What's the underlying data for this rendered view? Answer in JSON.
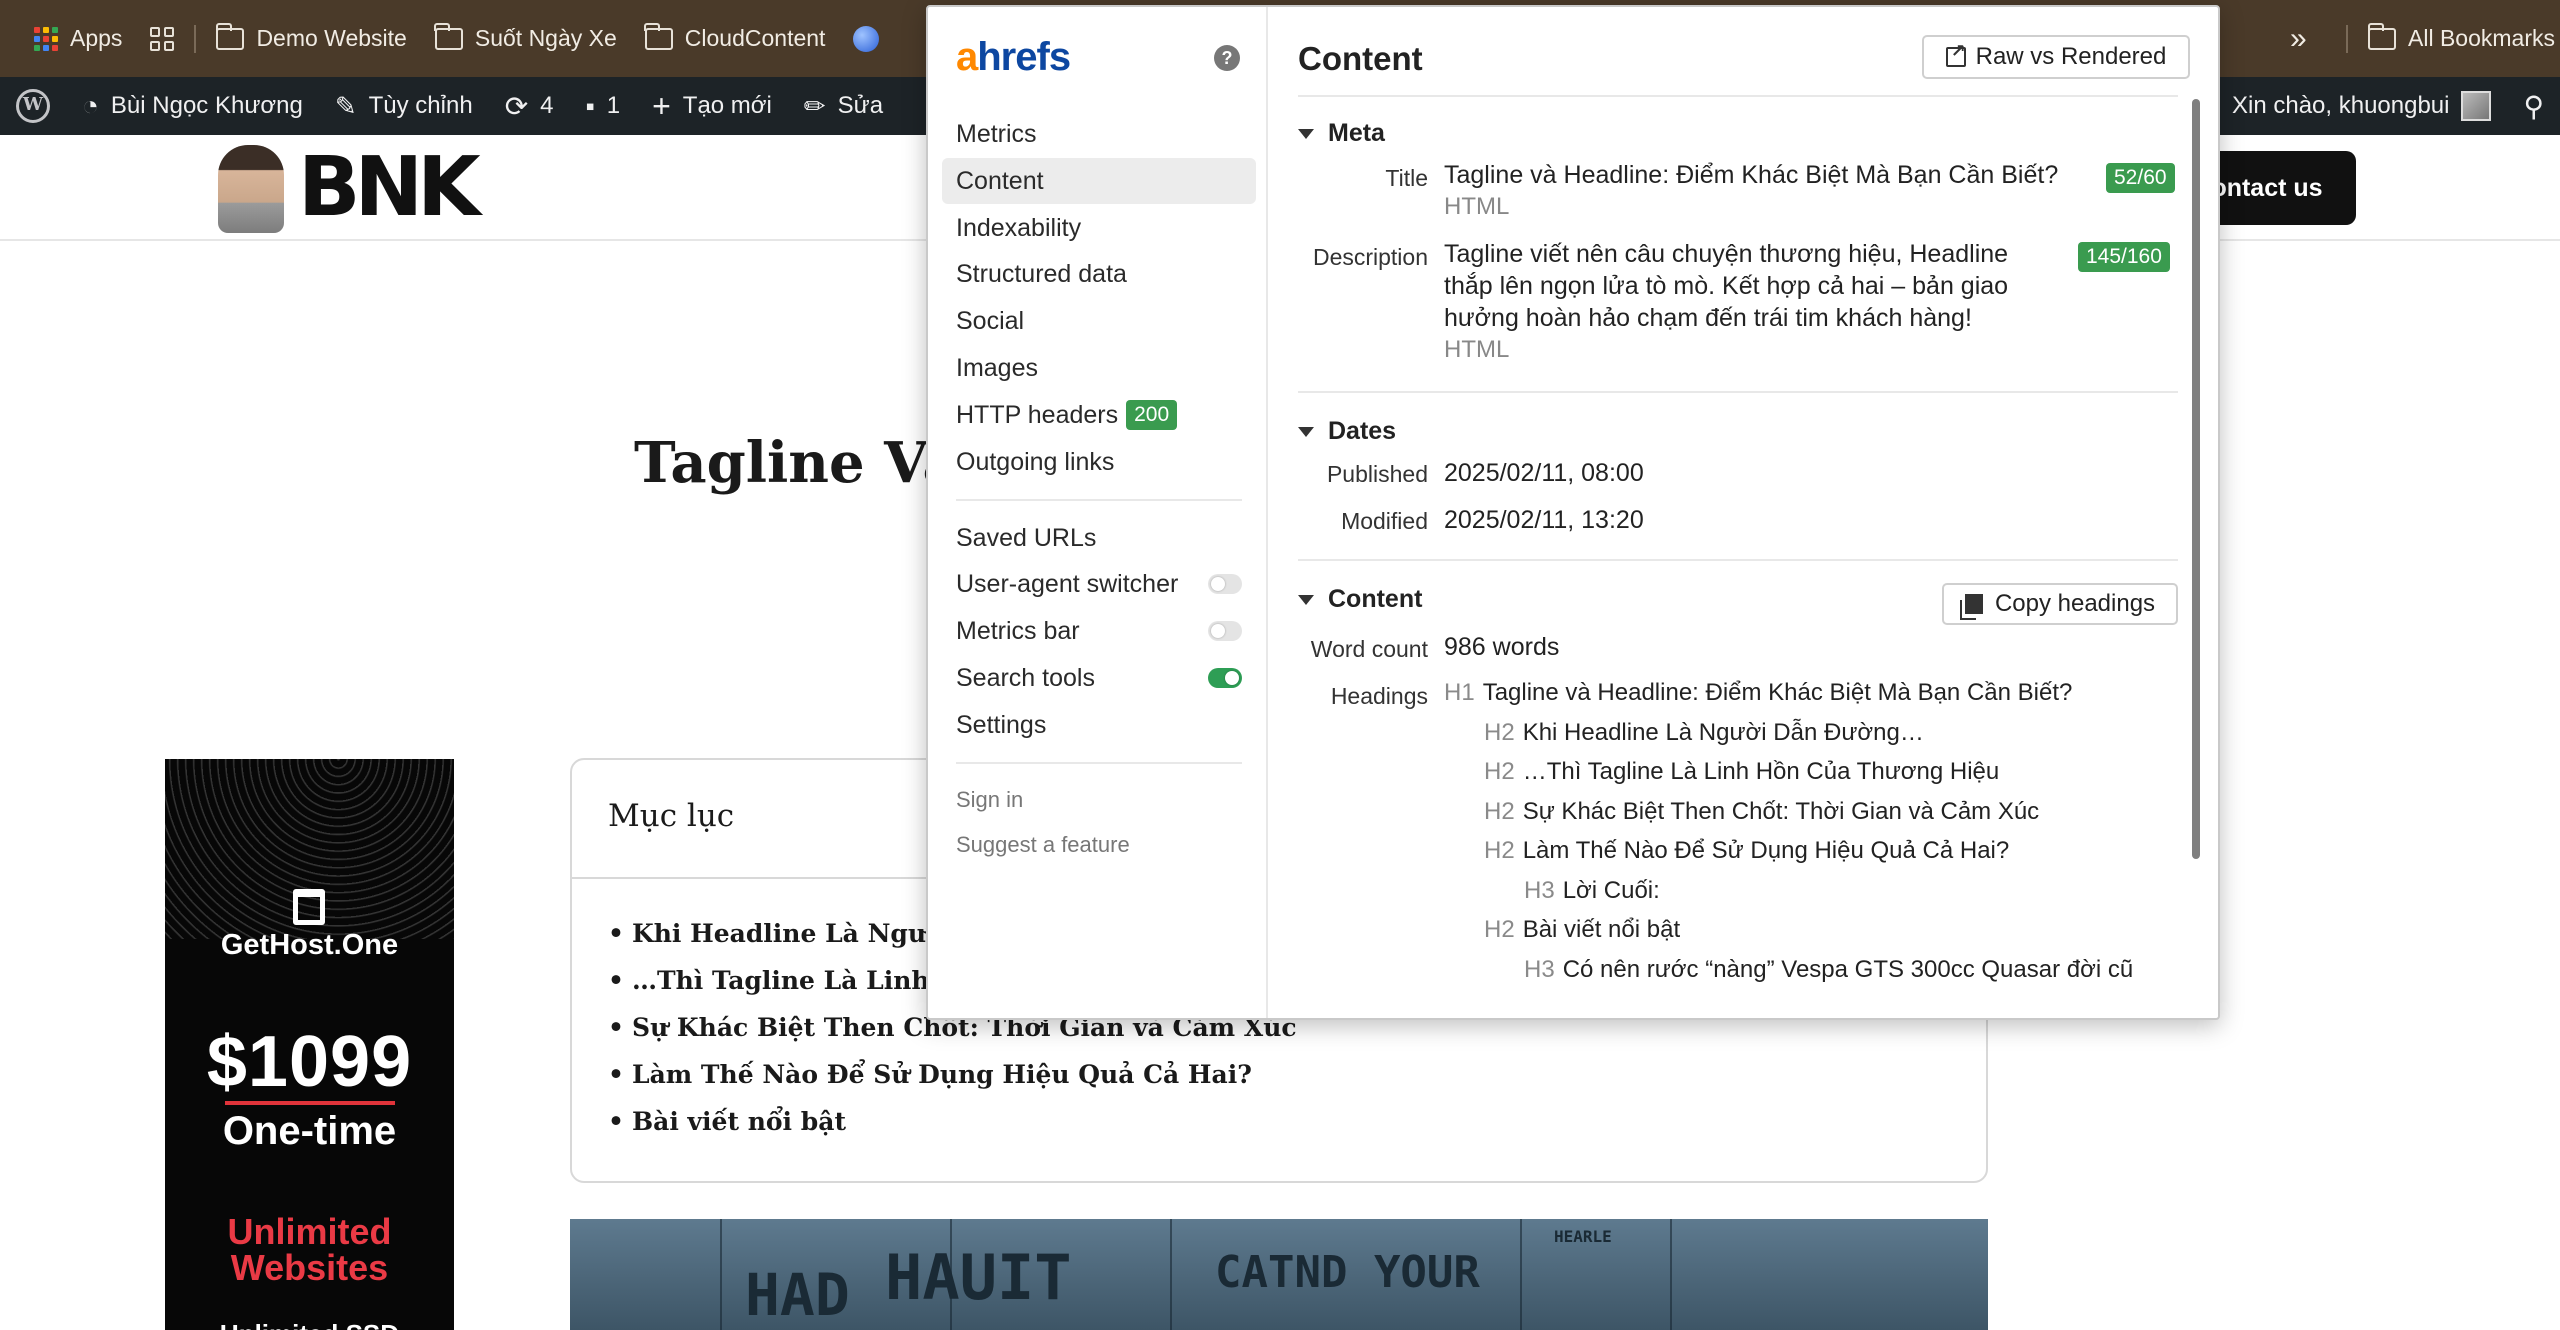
{
  "bookmarks": {
    "apps": "Apps",
    "items": [
      "Demo Website",
      "Suốt Ngày Xe",
      "CloudContent"
    ],
    "all_bookmarks": "All Bookmarks",
    "overflow": "»"
  },
  "wp_admin": {
    "site_name": "Bùi Ngọc Khương",
    "customize": "Tùy chỉnh",
    "updates_count": "4",
    "comments_count": "1",
    "new": "Tạo mới",
    "edit": "Sửa",
    "greeting": "Xin chào, khuongbui"
  },
  "site": {
    "logo": "BNK",
    "contact_button": "Contact us",
    "contact_visible": "ontact us"
  },
  "article": {
    "title": "Tagline Và",
    "toc_title": "Mục lục",
    "toc_items": [
      "Khi Headline Là Người Dẫn Đường…",
      "…Thì Tagline Là Linh Hồn Của Thương Hiệu",
      "Sự Khác Biệt Then Chốt: Thời Gian và Cảm Xúc",
      "Làm Thế Nào Để Sử Dụng Hiệu Quả Cả Hai?",
      "Bài viết nổi bật"
    ]
  },
  "ad": {
    "brand": "GetHost.One",
    "price": "$1099",
    "term": "One-time",
    "feature_line1": "Unlimited",
    "feature_line2": "Websites",
    "bottom": "Unlimited SSD"
  },
  "hero_image": {
    "texts": [
      "HAD",
      "HAUIT",
      "CATND YOUR",
      "HEARLE"
    ]
  },
  "ahrefs": {
    "logo_a": "a",
    "logo_rest": "hrefs",
    "help": "?",
    "nav": [
      {
        "label": "Metrics"
      },
      {
        "label": "Content",
        "active": true
      },
      {
        "label": "Indexability"
      },
      {
        "label": "Structured data"
      },
      {
        "label": "Social"
      },
      {
        "label": "Images"
      },
      {
        "label": "HTTP headers",
        "badge": "200"
      },
      {
        "label": "Outgoing links"
      }
    ],
    "tools": [
      {
        "label": "Saved URLs"
      },
      {
        "label": "User-agent switcher",
        "toggle": "off"
      },
      {
        "label": "Metrics bar",
        "toggle": "off"
      },
      {
        "label": "Search tools",
        "toggle": "on"
      },
      {
        "label": "Settings"
      }
    ],
    "account": [
      "Sign in",
      "Suggest a feature"
    ],
    "panel": {
      "title": "Content",
      "raw_button": "Raw vs Rendered",
      "meta": {
        "heading": "Meta",
        "title_label": "Title",
        "title_value": "Tagline và Headline: Điểm Khác Biệt Mà Bạn Cần Biết?",
        "title_source": "HTML",
        "title_count": "52/60",
        "description_label": "Description",
        "description_line1": "Tagline viết nên câu chuyện thương hiệu, Headline",
        "description_line2": "thắp lên ngọn lửa tò mò. Kết hợp cả hai – bản giao",
        "description_line3": "hưởng hoàn hảo chạm đến trái tim khách hàng!",
        "description_source": "HTML",
        "description_count": "145/160"
      },
      "dates": {
        "heading": "Dates",
        "published_label": "Published",
        "published_value": "2025/02/11, 08:00",
        "modified_label": "Modified",
        "modified_value": "2025/02/11, 13:20"
      },
      "content": {
        "heading": "Content",
        "copy_button": "Copy headings",
        "word_count_label": "Word count",
        "word_count_value": "986 words",
        "headings_label": "Headings",
        "headings": [
          {
            "tag": "H1",
            "text": "Tagline và Headline: Điểm Khác Biệt Mà Bạn Cần Biết?"
          },
          {
            "tag": "H2",
            "text": "Khi Headline Là Người Dẫn Đường…"
          },
          {
            "tag": "H2",
            "text": "…Thì Tagline Là Linh Hồn Của Thương Hiệu"
          },
          {
            "tag": "H2",
            "text": "Sự Khác Biệt Then Chốt: Thời Gian và Cảm Xúc"
          },
          {
            "tag": "H2",
            "text": "Làm Thế Nào Để Sử Dụng Hiệu Quả Cả Hai?"
          },
          {
            "tag": "H3",
            "text": "Lời Cuối:"
          },
          {
            "tag": "H2",
            "text": "Bài viết nổi bật"
          },
          {
            "tag": "H3",
            "text": "Có nên rước “nàng” Vespa GTS 300cc Quasar đời cũ"
          }
        ]
      }
    }
  }
}
